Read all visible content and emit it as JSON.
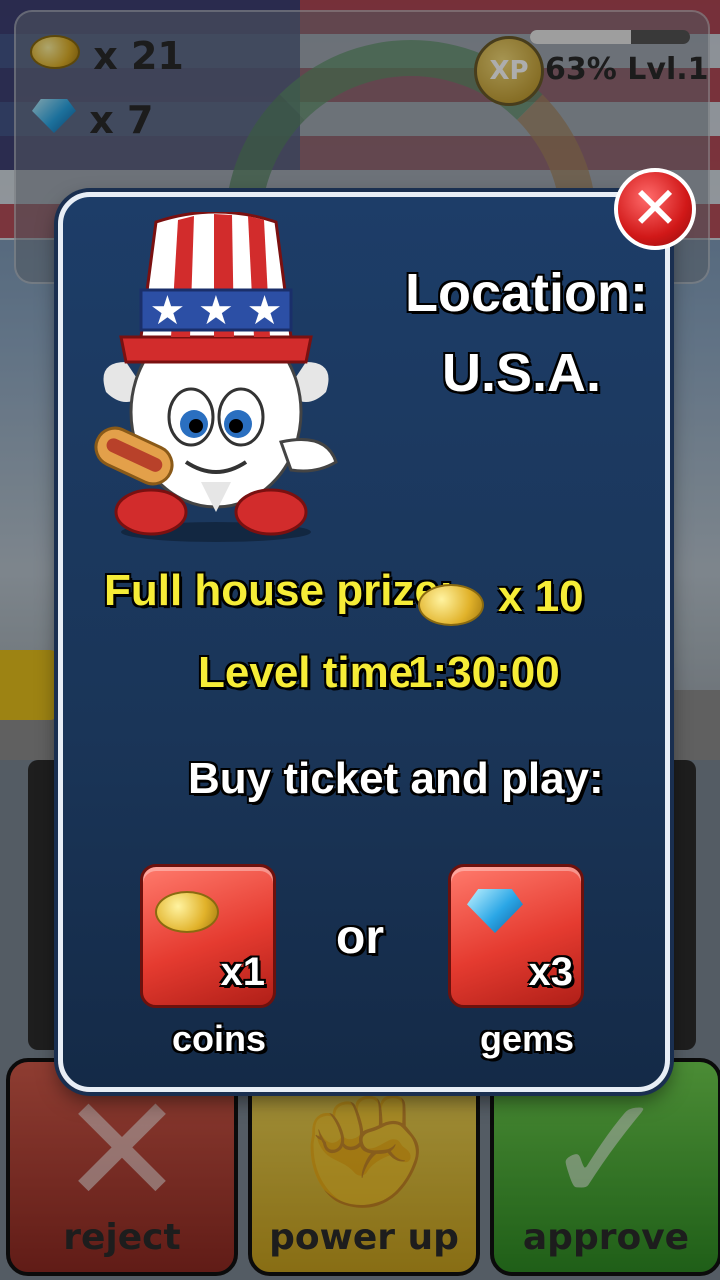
{
  "hud": {
    "coins": "x 21",
    "gems": "x 7",
    "xp_badge": "XP",
    "xp_percent": "63%",
    "level": "Lvl.1",
    "xp_progress": 0.63
  },
  "modal": {
    "location_label": "Location:",
    "location_value": "U.S.A.",
    "full_house_label": "Full house prize:",
    "full_house_value": "x 10",
    "level_time_label": "Level time:",
    "level_time_value": "1:30:00",
    "buy_title": "Buy ticket and play:",
    "or_label": "or",
    "coins_button": {
      "count": "x1",
      "caption": "coins"
    },
    "gems_button": {
      "count": "x3",
      "caption": "gems"
    }
  },
  "bottom": {
    "reject": "reject",
    "power_up": "power up",
    "approve": "approve"
  },
  "icons": [
    "coin-icon",
    "gem-icon",
    "close-icon",
    "uncle-sam-mascot-icon",
    "fist-icon",
    "check-icon",
    "x-icon"
  ],
  "colors": {
    "modal_bg": "#1d3d68",
    "yellow_text": "#f6ec37",
    "close_red": "#d11818",
    "buy_red": "#e53b30",
    "reject_red": "#d25a4a",
    "power_yellow": "#f0d75a",
    "approve_green": "#6fcf4f"
  }
}
